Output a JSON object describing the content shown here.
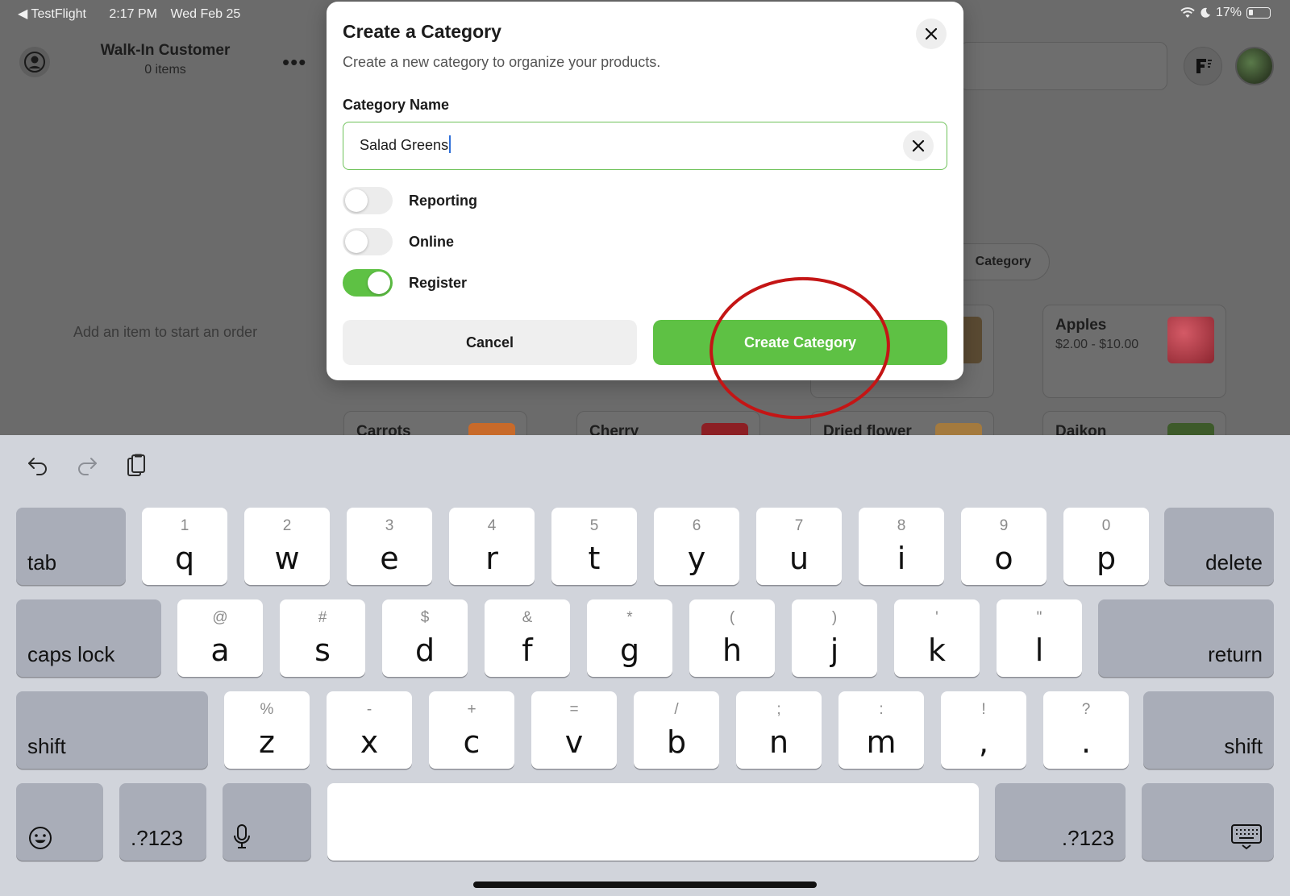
{
  "status_bar": {
    "back_app": "TestFlight",
    "time": "2:17 PM",
    "date": "Wed Feb 25",
    "battery": "17%"
  },
  "order": {
    "customer": "Walk-In Customer",
    "items": "0 items",
    "empty_hint": "Add an item to start an order"
  },
  "catalog": {
    "add_category_label": "Category",
    "products": [
      {
        "name": "Apples",
        "price": "$2.00 - $10.00",
        "thumb_color": "#b8434f"
      },
      {
        "name": "Carrots",
        "price": "",
        "thumb_color": "#c86a2a"
      },
      {
        "name": "Cherry",
        "price": "",
        "thumb_color": "#8c1f24"
      },
      {
        "name": "Dried flower",
        "price": "",
        "thumb_color": "#a47a3e"
      },
      {
        "name": "Daikon",
        "price": "",
        "thumb_color": "#3d5a2a"
      }
    ]
  },
  "modal": {
    "title": "Create a Category",
    "subtitle": "Create a new category to organize your products.",
    "field_label": "Category Name",
    "field_value": "Salad Greens",
    "toggles": [
      {
        "label": "Reporting",
        "on": false
      },
      {
        "label": "Online",
        "on": false
      },
      {
        "label": "Register",
        "on": true
      }
    ],
    "cancel_label": "Cancel",
    "create_label": "Create Category",
    "accent_color": "#5ec144",
    "annotation_color": "#c41515"
  },
  "keyboard": {
    "row1": [
      [
        "q",
        "1"
      ],
      [
        "w",
        "2"
      ],
      [
        "e",
        "3"
      ],
      [
        "r",
        "4"
      ],
      [
        "t",
        "5"
      ],
      [
        "y",
        "6"
      ],
      [
        "u",
        "7"
      ],
      [
        "i",
        "8"
      ],
      [
        "o",
        "9"
      ],
      [
        "p",
        "0"
      ]
    ],
    "row2": [
      [
        "a",
        "@"
      ],
      [
        "s",
        "#"
      ],
      [
        "d",
        "$"
      ],
      [
        "f",
        "&"
      ],
      [
        "g",
        "*"
      ],
      [
        "h",
        "("
      ],
      [
        "j",
        ")"
      ],
      [
        "k",
        "'"
      ],
      [
        "l",
        "\""
      ]
    ],
    "row3": [
      [
        "z",
        "%"
      ],
      [
        "x",
        "-"
      ],
      [
        "c",
        "+"
      ],
      [
        "v",
        "="
      ],
      [
        "b",
        "/"
      ],
      [
        "n",
        ";"
      ],
      [
        "m",
        ":"
      ],
      [
        ",",
        "!"
      ],
      [
        ".",
        "?"
      ]
    ],
    "tab": "tab",
    "delete": "delete",
    "caps_lock": "caps lock",
    "return": "return",
    "shift": "shift",
    "numbers": ".?123"
  }
}
